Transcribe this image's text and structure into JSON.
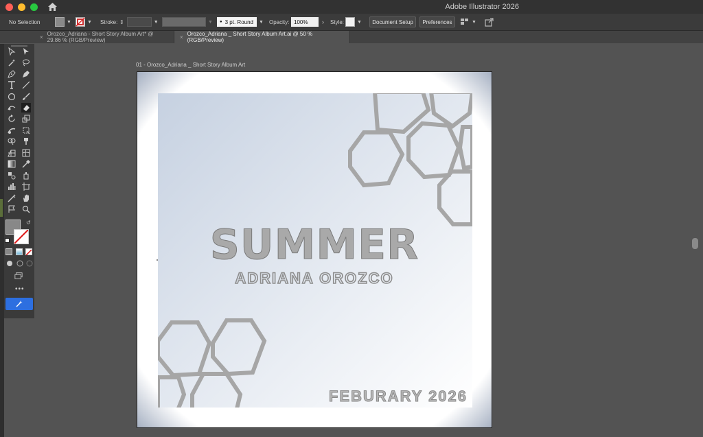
{
  "window": {
    "title": "Adobe Illustrator 2026"
  },
  "controlbar": {
    "selection": "No Selection",
    "stroke_label": "Stroke:",
    "brush_value": "3 pt. Round",
    "opacity_label": "Opacity:",
    "opacity_value": "100%",
    "style_label": "Style:",
    "document_setup": "Document Setup",
    "preferences": "Preferences"
  },
  "tabs": [
    {
      "label": "Orozco_Adriana - Short Story Album Art* @ 29.86 % (RGB/Preview)",
      "active": false
    },
    {
      "label": "Orozco_Adriana _ Short Story Album Art.ai @ 50 % (RGB/Preview)",
      "active": true
    }
  ],
  "artboard": {
    "name": "01 - Orozco_Adriana _ Short Story Album Art",
    "title": "SUMMER",
    "artist": "ADRIANA OROZCO",
    "date": "FEBURARY 2026"
  },
  "colors": {
    "accent": "#2d6fe0",
    "hexagon": "#a6a6a6",
    "gradient_top": "#c9d4e3",
    "gradient_bottom": "#ffffff"
  },
  "icons": [
    "home-icon",
    "selection-tool-icon",
    "direct-selection-tool-icon",
    "magic-wand-icon",
    "lasso-icon",
    "pen-icon",
    "curvature-icon",
    "type-icon",
    "line-icon",
    "ellipse-icon",
    "paintbrush-icon",
    "shaper-icon",
    "eraser-icon",
    "rotate-icon",
    "scale-icon",
    "warp-icon",
    "free-transform-icon",
    "shape-builder-icon",
    "live-paint-icon",
    "perspective-icon",
    "mesh-icon",
    "gradient-icon",
    "eyedropper-icon",
    "blend-icon",
    "symbol-sprayer-icon",
    "graph-icon",
    "artboard-icon",
    "slice-icon",
    "hand-icon",
    "zoom-icon",
    "fill-icon",
    "stroke-icon",
    "more-icon",
    "magic-icon"
  ]
}
